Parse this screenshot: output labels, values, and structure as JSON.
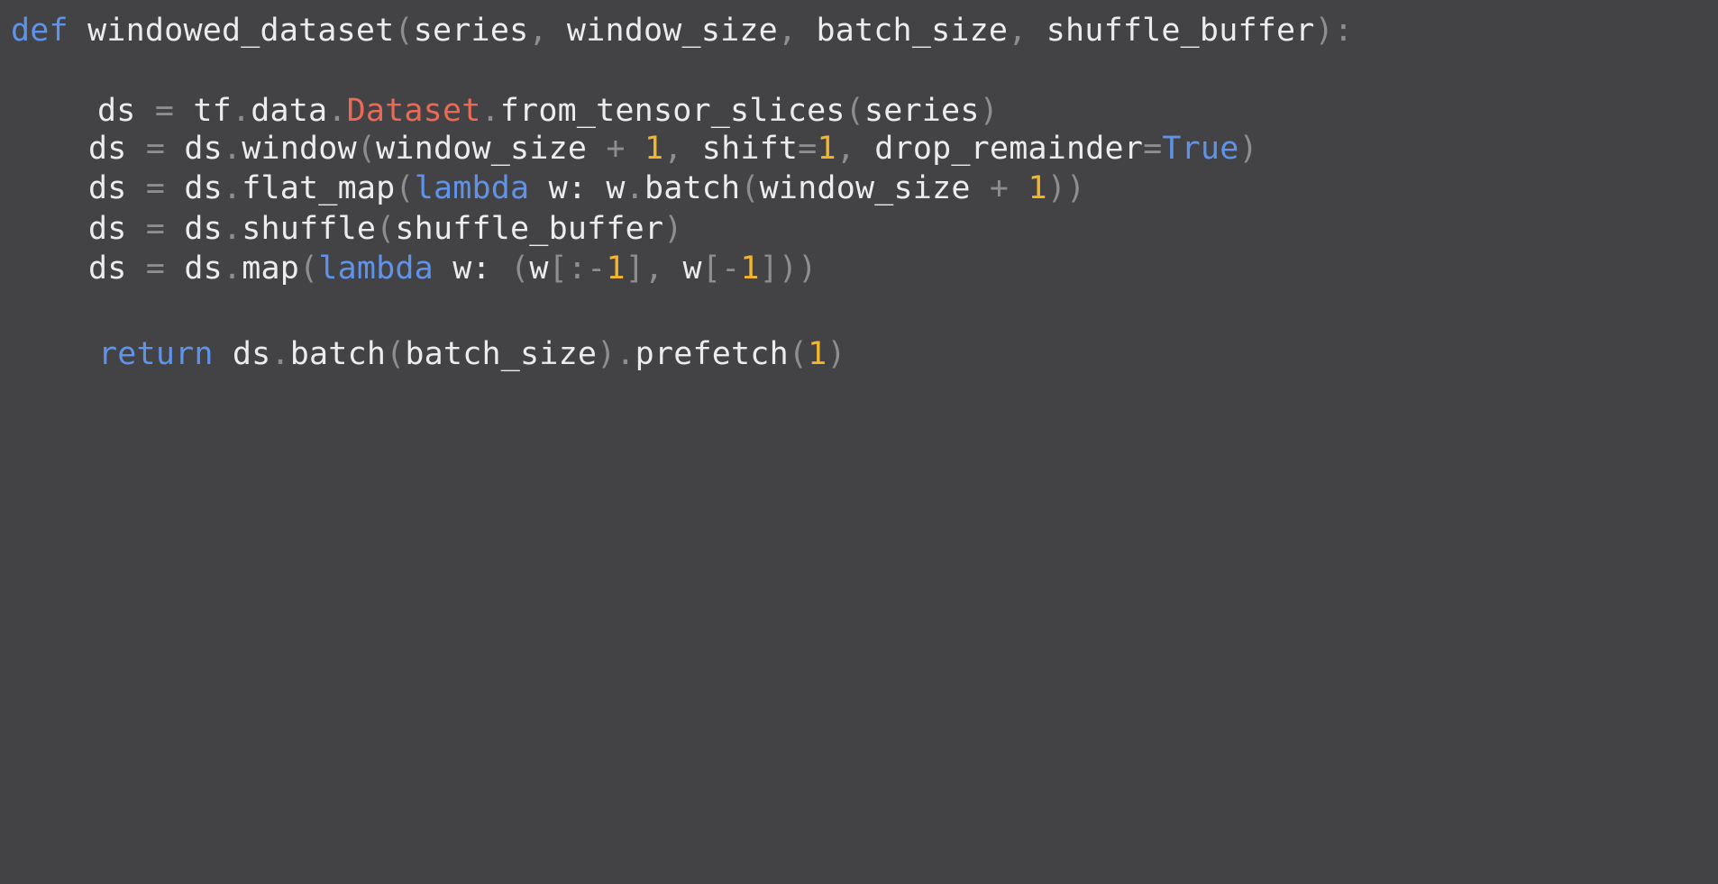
{
  "colors": {
    "background": "#434345",
    "keyword": "#5f93ea",
    "class": "#ec6a55",
    "number": "#f3b52c",
    "punctuation": "#8e8e90",
    "identifier": "#ececec"
  },
  "code": {
    "lines": [
      {
        "tokens": [
          [
            "def",
            "kw"
          ],
          [
            " windowed_dataset",
            "id"
          ],
          [
            "(",
            "p"
          ],
          [
            "series",
            "id"
          ],
          [
            ",",
            "p"
          ],
          [
            " window_size",
            "id"
          ],
          [
            ",",
            "p"
          ],
          [
            " batch_size",
            "id"
          ],
          [
            ",",
            "p"
          ],
          [
            " shuffle_buffer",
            "id"
          ],
          [
            ")",
            "p"
          ],
          [
            ":",
            "p"
          ]
        ]
      },
      {
        "tokens": [
          [
            "ds ",
            "id"
          ],
          [
            "=",
            "p"
          ],
          [
            " tf",
            "id"
          ],
          [
            ".",
            "p"
          ],
          [
            "data",
            "id"
          ],
          [
            ".",
            "p"
          ],
          [
            "Dataset",
            "cls"
          ],
          [
            ".",
            "p"
          ],
          [
            "from_tensor_slices",
            "id"
          ],
          [
            "(",
            "p"
          ],
          [
            "series",
            "id"
          ],
          [
            ")",
            "p"
          ]
        ]
      },
      {
        "tokens": [
          [
            "ds ",
            "id"
          ],
          [
            "=",
            "p"
          ],
          [
            " ds",
            "id"
          ],
          [
            ".",
            "p"
          ],
          [
            "window",
            "id"
          ],
          [
            "(",
            "p"
          ],
          [
            "window_size ",
            "id"
          ],
          [
            "+",
            "p"
          ],
          [
            " ",
            "id"
          ],
          [
            "1",
            "num"
          ],
          [
            ",",
            "p"
          ],
          [
            " shift",
            "id"
          ],
          [
            "=",
            "p"
          ],
          [
            "1",
            "num"
          ],
          [
            ",",
            "p"
          ],
          [
            " drop_remainder",
            "id"
          ],
          [
            "=",
            "p"
          ],
          [
            "True",
            "kw"
          ],
          [
            ")",
            "p"
          ]
        ]
      },
      {
        "tokens": [
          [
            "ds ",
            "id"
          ],
          [
            "=",
            "p"
          ],
          [
            " ds",
            "id"
          ],
          [
            ".",
            "p"
          ],
          [
            "flat_map",
            "id"
          ],
          [
            "(",
            "p"
          ],
          [
            "lambda",
            "kw"
          ],
          [
            " w: w",
            "id"
          ],
          [
            ".",
            "p"
          ],
          [
            "batch",
            "id"
          ],
          [
            "(",
            "p"
          ],
          [
            "window_size ",
            "id"
          ],
          [
            "+",
            "p"
          ],
          [
            " ",
            "id"
          ],
          [
            "1",
            "num"
          ],
          [
            "))",
            "p"
          ]
        ]
      },
      {
        "tokens": [
          [
            "ds ",
            "id"
          ],
          [
            "=",
            "p"
          ],
          [
            " ds",
            "id"
          ],
          [
            ".",
            "p"
          ],
          [
            "shuffle",
            "id"
          ],
          [
            "(",
            "p"
          ],
          [
            "shuffle_buffer",
            "id"
          ],
          [
            ")",
            "p"
          ]
        ]
      },
      {
        "tokens": [
          [
            "ds ",
            "id"
          ],
          [
            "=",
            "p"
          ],
          [
            " ds",
            "id"
          ],
          [
            ".",
            "p"
          ],
          [
            "map",
            "id"
          ],
          [
            "(",
            "p"
          ],
          [
            "lambda",
            "kw"
          ],
          [
            " w: ",
            "id"
          ],
          [
            "(",
            "p"
          ],
          [
            "w",
            "id"
          ],
          [
            "[:-",
            "p"
          ],
          [
            "1",
            "num"
          ],
          [
            "],",
            "p"
          ],
          [
            " w",
            "id"
          ],
          [
            "[-",
            "p"
          ],
          [
            "1",
            "num"
          ],
          [
            "]))",
            "p"
          ]
        ]
      },
      {
        "tokens": [
          [
            "return",
            "kw"
          ],
          [
            " ds",
            "id"
          ],
          [
            ".",
            "p"
          ],
          [
            "batch",
            "id"
          ],
          [
            "(",
            "p"
          ],
          [
            "batch_size",
            "id"
          ],
          [
            ")",
            "p"
          ],
          [
            ".",
            "p"
          ],
          [
            "prefetch",
            "id"
          ],
          [
            "(",
            "p"
          ],
          [
            "1",
            "num"
          ],
          [
            ")",
            "p"
          ]
        ]
      }
    ]
  }
}
